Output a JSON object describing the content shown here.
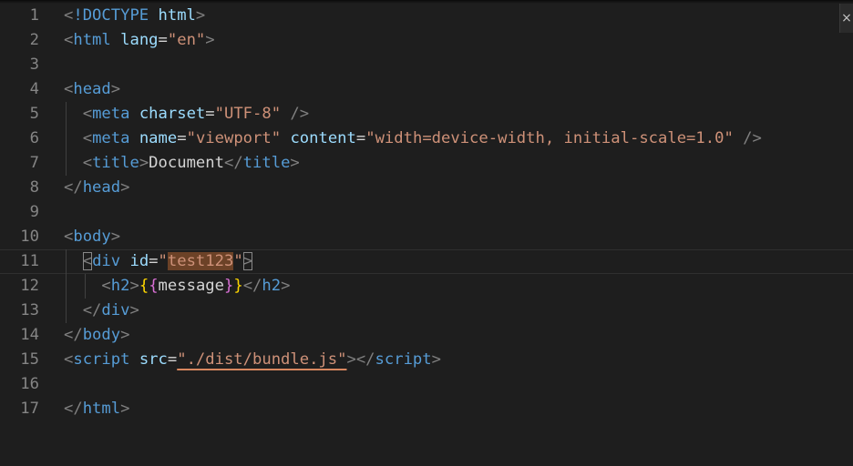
{
  "editor": {
    "language": "html",
    "current_line": 11,
    "close_glyph": "×",
    "lines": [
      {
        "n": "1",
        "tokens": [
          {
            "c": "tok-punc",
            "t": "<"
          },
          {
            "c": "tok-tag",
            "t": "!DOCTYPE"
          },
          {
            "c": "tok-text",
            "t": " "
          },
          {
            "c": "tok-attr",
            "t": "html"
          },
          {
            "c": "tok-punc",
            "t": ">"
          }
        ]
      },
      {
        "n": "2",
        "tokens": [
          {
            "c": "tok-punc",
            "t": "<"
          },
          {
            "c": "tok-tag",
            "t": "html"
          },
          {
            "c": "tok-text",
            "t": " "
          },
          {
            "c": "tok-attr",
            "t": "lang"
          },
          {
            "c": "tok-text",
            "t": "="
          },
          {
            "c": "tok-str",
            "t": "\"en\""
          },
          {
            "c": "tok-punc",
            "t": ">"
          }
        ]
      },
      {
        "n": "3",
        "tokens": []
      },
      {
        "n": "4",
        "tokens": [
          {
            "c": "tok-punc",
            "t": "<"
          },
          {
            "c": "tok-tag",
            "t": "head"
          },
          {
            "c": "tok-punc",
            "t": ">"
          }
        ]
      },
      {
        "n": "5",
        "tokens": [
          {
            "c": "tok-text",
            "t": "  "
          },
          {
            "c": "tok-punc",
            "t": "<"
          },
          {
            "c": "tok-tag",
            "t": "meta"
          },
          {
            "c": "tok-text",
            "t": " "
          },
          {
            "c": "tok-attr",
            "t": "charset"
          },
          {
            "c": "tok-text",
            "t": "="
          },
          {
            "c": "tok-str",
            "t": "\"UTF-8\""
          },
          {
            "c": "tok-text",
            "t": " "
          },
          {
            "c": "tok-punc",
            "t": "/>"
          }
        ]
      },
      {
        "n": "6",
        "tokens": [
          {
            "c": "tok-text",
            "t": "  "
          },
          {
            "c": "tok-punc",
            "t": "<"
          },
          {
            "c": "tok-tag",
            "t": "meta"
          },
          {
            "c": "tok-text",
            "t": " "
          },
          {
            "c": "tok-attr",
            "t": "name"
          },
          {
            "c": "tok-text",
            "t": "="
          },
          {
            "c": "tok-str",
            "t": "\"viewport\""
          },
          {
            "c": "tok-text",
            "t": " "
          },
          {
            "c": "tok-attr",
            "t": "content"
          },
          {
            "c": "tok-text",
            "t": "="
          },
          {
            "c": "tok-str",
            "t": "\"width=device-width, initial-scale=1.0\""
          },
          {
            "c": "tok-text",
            "t": " "
          },
          {
            "c": "tok-punc",
            "t": "/>"
          }
        ]
      },
      {
        "n": "7",
        "tokens": [
          {
            "c": "tok-text",
            "t": "  "
          },
          {
            "c": "tok-punc",
            "t": "<"
          },
          {
            "c": "tok-tag",
            "t": "title"
          },
          {
            "c": "tok-punc",
            "t": ">"
          },
          {
            "c": "tok-text",
            "t": "Document"
          },
          {
            "c": "tok-punc",
            "t": "</"
          },
          {
            "c": "tok-tag",
            "t": "title"
          },
          {
            "c": "tok-punc",
            "t": ">"
          }
        ]
      },
      {
        "n": "8",
        "tokens": [
          {
            "c": "tok-punc",
            "t": "</"
          },
          {
            "c": "tok-tag",
            "t": "head"
          },
          {
            "c": "tok-punc",
            "t": ">"
          }
        ]
      },
      {
        "n": "9",
        "tokens": []
      },
      {
        "n": "10",
        "tokens": [
          {
            "c": "tok-punc",
            "t": "<"
          },
          {
            "c": "tok-tag",
            "t": "body"
          },
          {
            "c": "tok-punc",
            "t": ">"
          }
        ]
      },
      {
        "n": "11",
        "tokens": [
          {
            "c": "tok-text",
            "t": "  "
          },
          {
            "c": "tok-punc bracket-box",
            "t": "<"
          },
          {
            "c": "tok-tag",
            "t": "div"
          },
          {
            "c": "tok-text",
            "t": " "
          },
          {
            "c": "tok-attr",
            "t": "id"
          },
          {
            "c": "tok-text",
            "t": "="
          },
          {
            "c": "tok-str",
            "t": "\""
          },
          {
            "c": "tok-str hl-match",
            "t": "test123"
          },
          {
            "c": "tok-str",
            "t": "\""
          },
          {
            "c": "tok-punc bracket-box",
            "t": ">"
          }
        ]
      },
      {
        "n": "12",
        "tokens": [
          {
            "c": "tok-text",
            "t": "    "
          },
          {
            "c": "tok-punc",
            "t": "<"
          },
          {
            "c": "tok-tag",
            "t": "h2"
          },
          {
            "c": "tok-punc",
            "t": ">"
          },
          {
            "c": "tok-brace1",
            "t": "{"
          },
          {
            "c": "tok-brace2",
            "t": "{"
          },
          {
            "c": "tok-text",
            "t": "message"
          },
          {
            "c": "tok-brace2",
            "t": "}"
          },
          {
            "c": "tok-brace1",
            "t": "}"
          },
          {
            "c": "tok-punc",
            "t": "</"
          },
          {
            "c": "tok-tag",
            "t": "h2"
          },
          {
            "c": "tok-punc",
            "t": ">"
          }
        ]
      },
      {
        "n": "13",
        "tokens": [
          {
            "c": "tok-text",
            "t": "  "
          },
          {
            "c": "tok-punc",
            "t": "</"
          },
          {
            "c": "tok-tag",
            "t": "div"
          },
          {
            "c": "tok-punc",
            "t": ">"
          }
        ]
      },
      {
        "n": "14",
        "tokens": [
          {
            "c": "tok-punc",
            "t": "</"
          },
          {
            "c": "tok-tag",
            "t": "body"
          },
          {
            "c": "tok-punc",
            "t": ">"
          }
        ]
      },
      {
        "n": "15",
        "tokens": [
          {
            "c": "tok-punc",
            "t": "<"
          },
          {
            "c": "tok-tag",
            "t": "script"
          },
          {
            "c": "tok-text",
            "t": " "
          },
          {
            "c": "tok-attr",
            "t": "src"
          },
          {
            "c": "tok-text",
            "t": "="
          },
          {
            "c": "tok-str squiggle",
            "t": "\"./dist/bundle.js\""
          },
          {
            "c": "tok-punc",
            "t": "></"
          },
          {
            "c": "tok-tag",
            "t": "script"
          },
          {
            "c": "tok-punc",
            "t": ">"
          }
        ]
      },
      {
        "n": "16",
        "tokens": []
      },
      {
        "n": "17",
        "tokens": [
          {
            "c": "tok-punc",
            "t": "</"
          },
          {
            "c": "tok-tag",
            "t": "html"
          },
          {
            "c": "tok-punc",
            "t": ">"
          }
        ]
      }
    ]
  }
}
